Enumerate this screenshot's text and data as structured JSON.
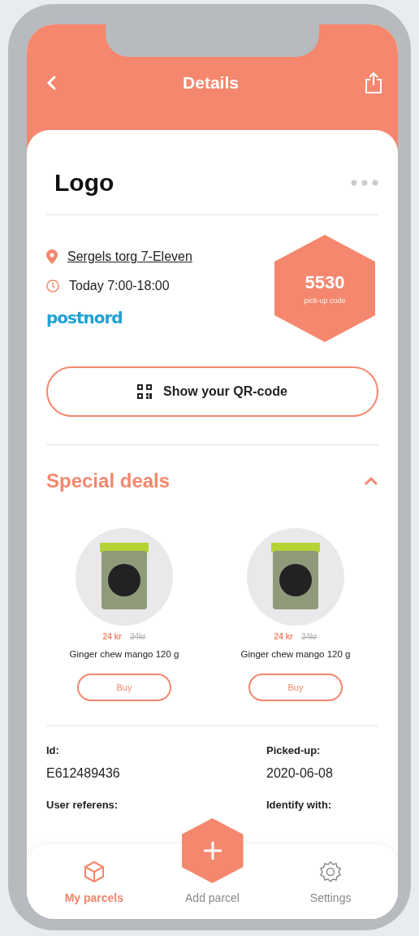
{
  "header": {
    "title": "Details"
  },
  "card": {
    "title": "Logo",
    "location": "Sergels torg 7-Eleven",
    "hours": "Today 7:00-18:00",
    "carrier": "postnord",
    "code": "5530",
    "code_label": "pick-up code",
    "qr_button": "Show your QR-code"
  },
  "deals": {
    "title": "Special deals",
    "expanded": true,
    "items": [
      {
        "price": "24 kr",
        "old_price": "34kr",
        "name": "Ginger chew mango 120 g",
        "button": "Buy"
      },
      {
        "price": "24 kr",
        "old_price": "34kr",
        "name": "Ginger chew mango 120 g",
        "button": "Buy"
      }
    ]
  },
  "info": [
    {
      "label": "Id:",
      "value": "E612489436"
    },
    {
      "label": "Picked-up:",
      "value": "2020-06-08"
    },
    {
      "label": "User referens:"
    },
    {
      "label": "Identify with:"
    }
  ],
  "nav": [
    {
      "kind": "parcels",
      "label": "My parcels",
      "selected": true
    },
    {
      "kind": "add",
      "label": "Add parcel",
      "selected": false
    },
    {
      "kind": "settings",
      "label": "Settings",
      "selected": false
    }
  ]
}
